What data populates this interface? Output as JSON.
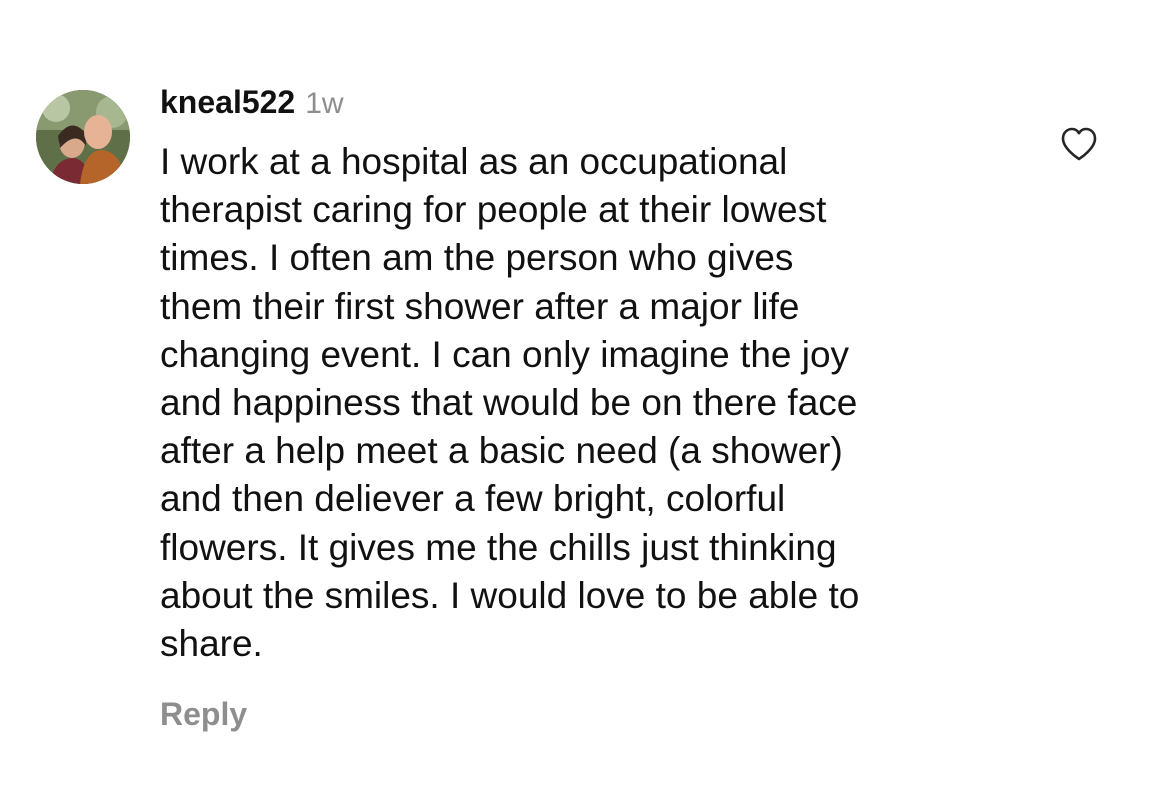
{
  "comment": {
    "username": "kneal522",
    "time": "1w",
    "text": "I work at a hospital as an occupational\ntherapist caring for people at their lowest\ntimes. I often am the person who gives\nthem their first shower after a major life\nchanging event. I can only imagine the joy\nand happiness that would be on there face\nafter a help meet a basic need (a shower)\nand then deliever a few bright, colorful\nflowers. It gives me the chills just thinking\nabout the smiles. I would love to be able to\nshare.",
    "reply_label": "Reply",
    "like_icon": "heart-outline-icon",
    "avatar_icon": "profile-photo"
  },
  "colors": {
    "text": "#111111",
    "muted": "#8e8e8e",
    "background": "#ffffff"
  }
}
